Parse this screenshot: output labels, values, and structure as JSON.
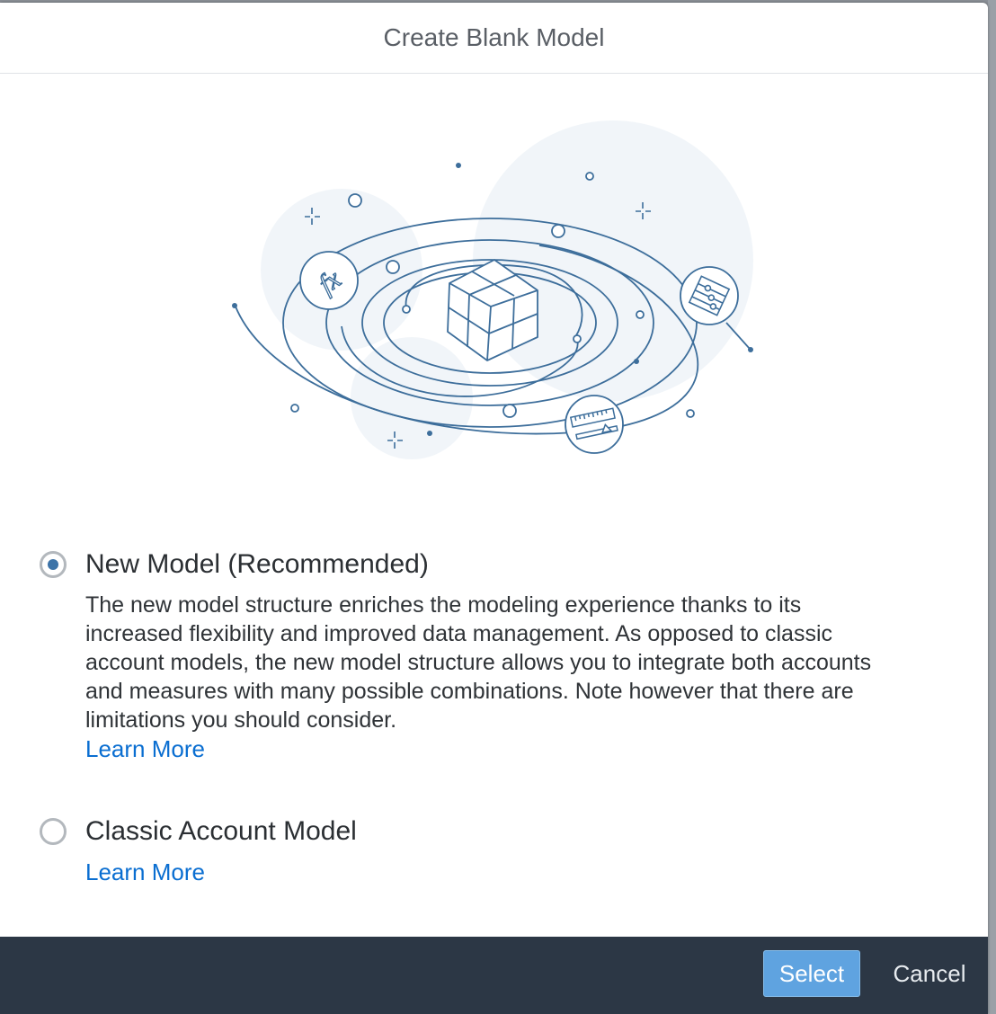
{
  "dialog": {
    "title": "Create Blank Model"
  },
  "options": [
    {
      "label": "New Model (Recommended)",
      "selected": true,
      "description": "The new model structure enriches the modeling experience thanks to its increased flexibility and improved data management. As opposed to classic account models, the new model structure allows you to integrate both accounts and measures with many possible combinations. Note however that there are limitations you should consider.",
      "link": "Learn More"
    },
    {
      "label": "Classic Account Model",
      "selected": false,
      "link": "Learn More"
    }
  ],
  "footer": {
    "select_label": "Select",
    "cancel_label": "Cancel"
  },
  "illustration": {
    "badges": [
      "fx-formula-icon",
      "abacus-icon",
      "ruler-slider-icon"
    ],
    "formula_badge_text": "fx"
  },
  "colors": {
    "accent": "#0a6ed1",
    "radio_selected": "#3c73a8",
    "footer_bg": "#2c3745",
    "primary_button": "#5fa3e0",
    "illustration_stroke": "#3d6e9b"
  }
}
